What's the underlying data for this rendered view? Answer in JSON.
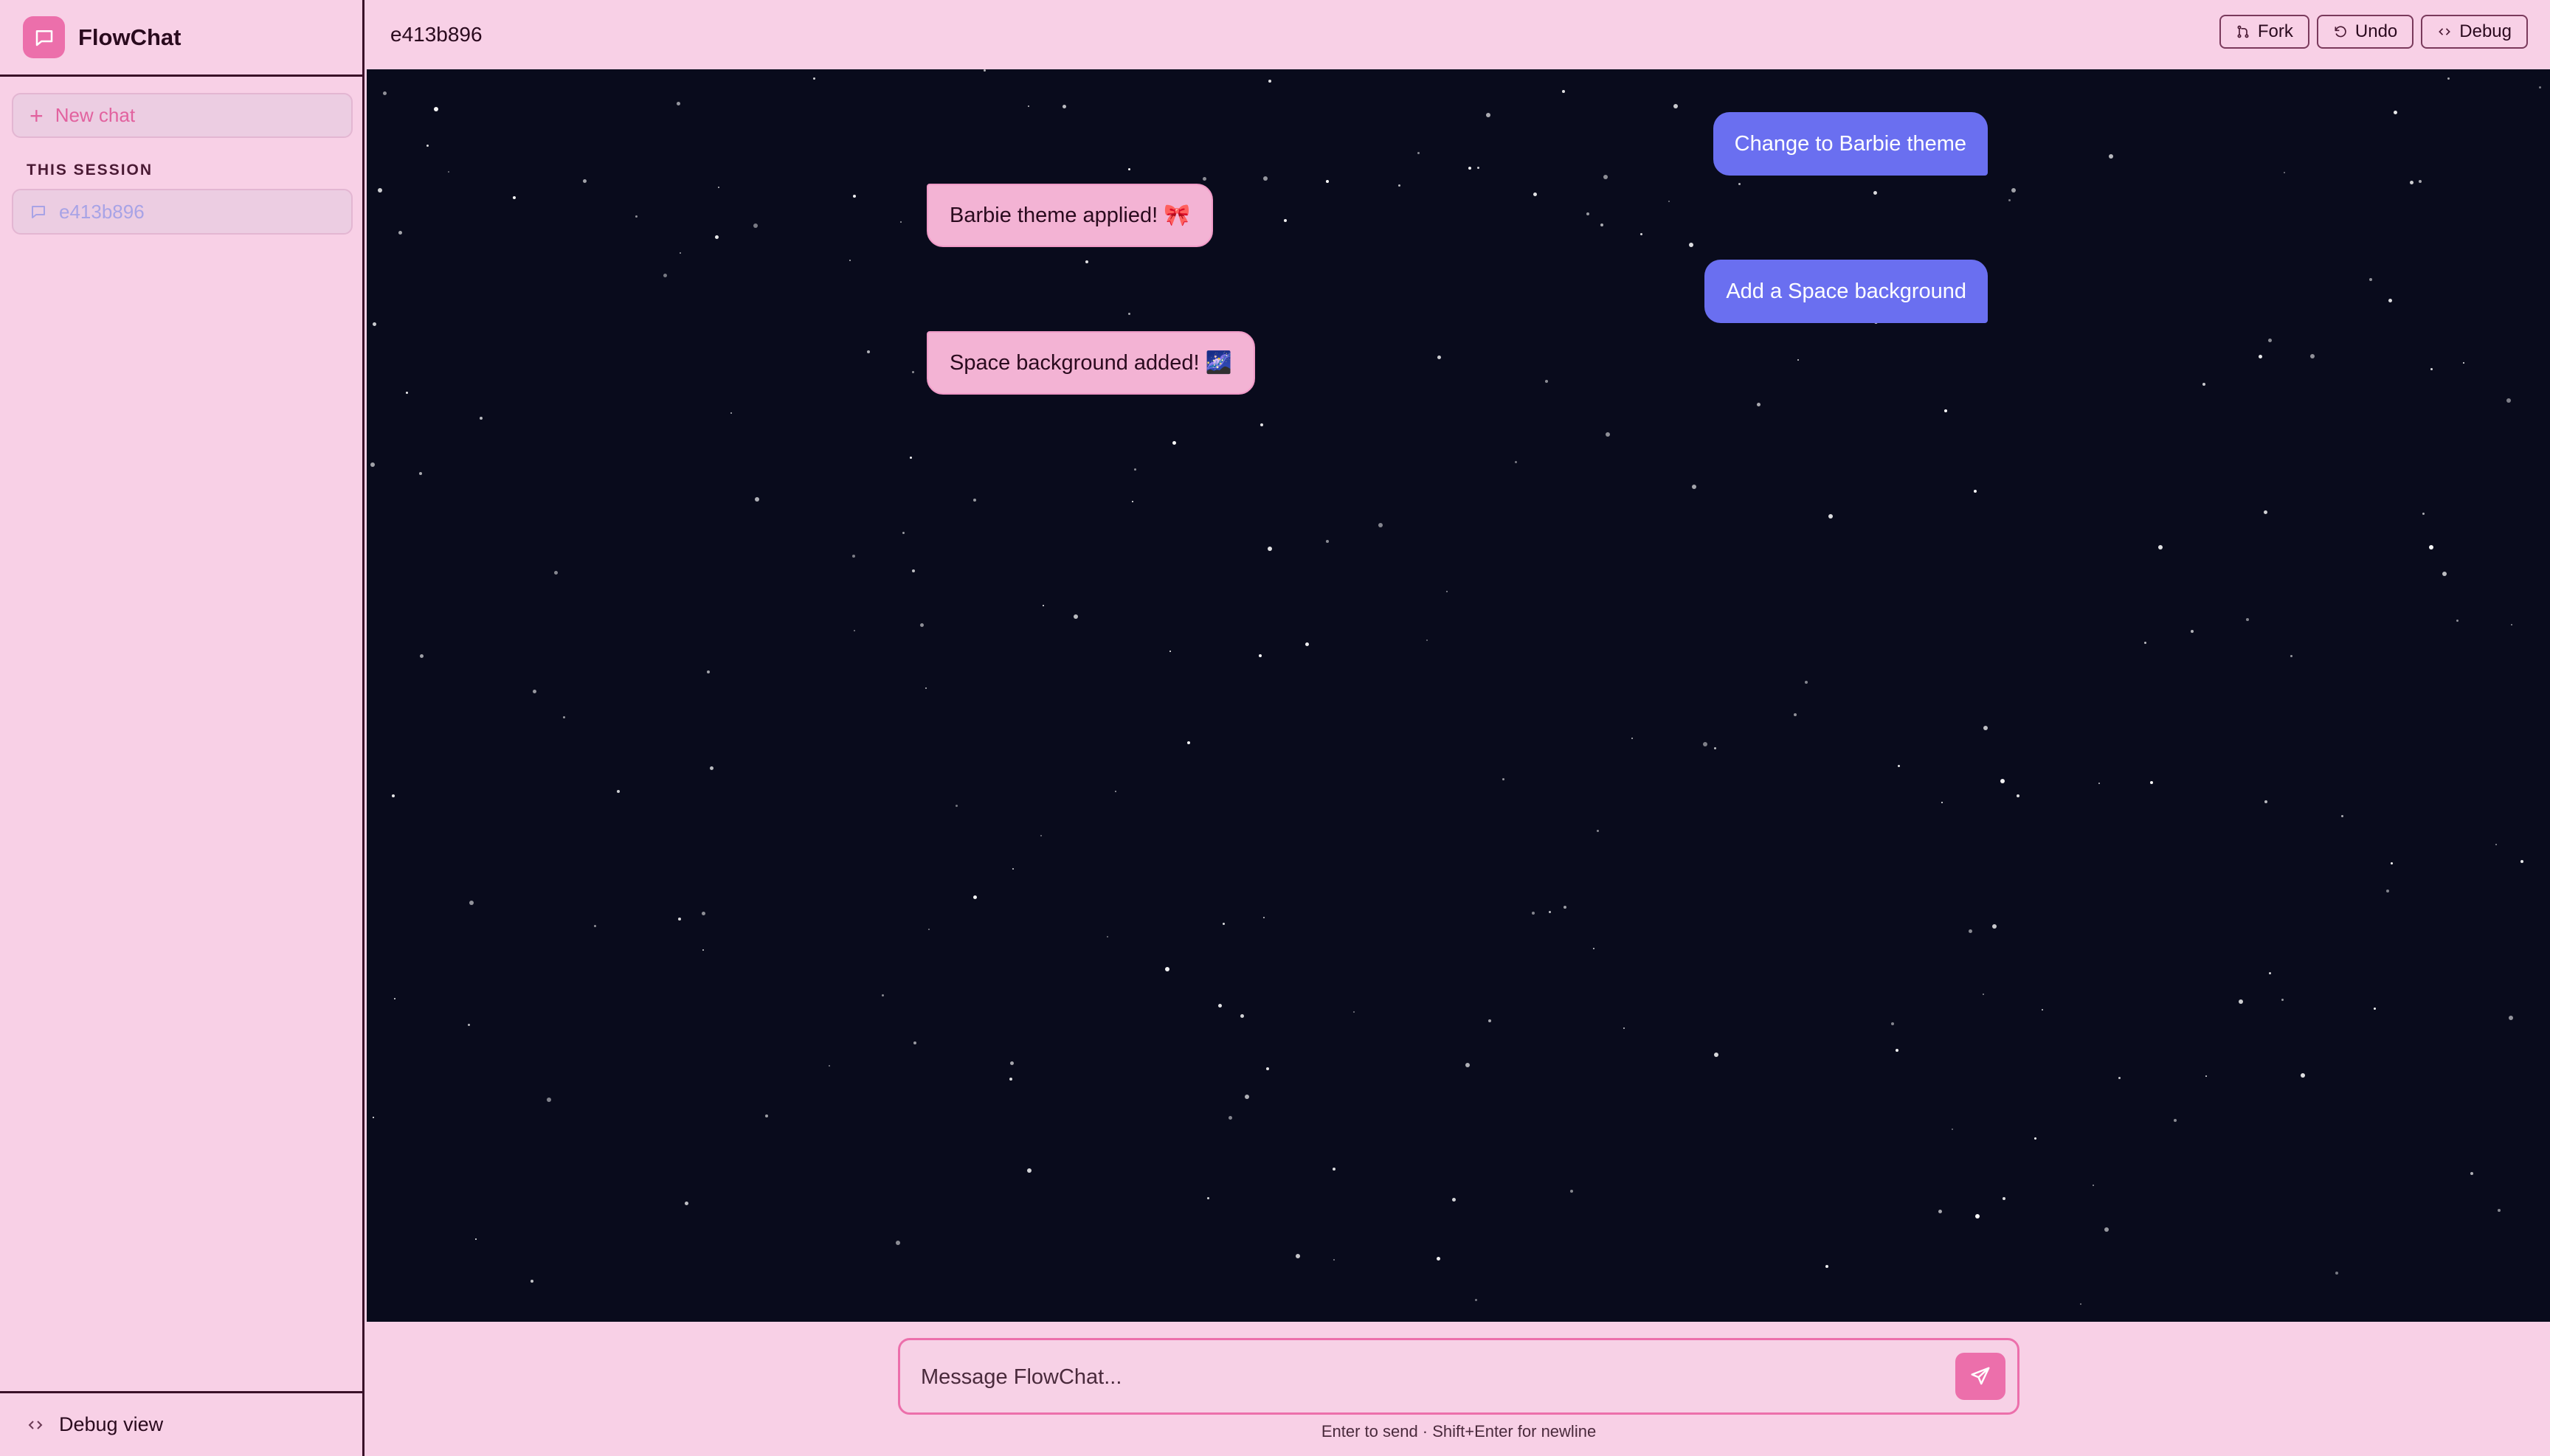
{
  "app": {
    "name": "FlowChat"
  },
  "sidebar": {
    "new_chat_label": "New chat",
    "section_label": "THIS SESSION",
    "sessions": [
      {
        "label": "e413b896"
      }
    ],
    "debug_view_label": "Debug view"
  },
  "header": {
    "title": "e413b896",
    "actions": {
      "fork": "Fork",
      "undo": "Undo",
      "debug": "Debug"
    }
  },
  "messages": [
    {
      "role": "user",
      "text": "Change to Barbie theme"
    },
    {
      "role": "assistant",
      "text": "Barbie theme applied! 🎀"
    },
    {
      "role": "user",
      "text": "Add a Space background"
    },
    {
      "role": "assistant",
      "text": "Space background added! 🌌"
    }
  ],
  "composer": {
    "placeholder": "Message FlowChat...",
    "hint": "Enter to send · Shift+Enter for newline"
  },
  "colors": {
    "accent": "#ec6fab",
    "user_bubble": "#6a6ff0",
    "bot_bubble": "#f3b3d4",
    "space_bg": "#090b1c",
    "panel_bg": "#f8d0e6"
  }
}
